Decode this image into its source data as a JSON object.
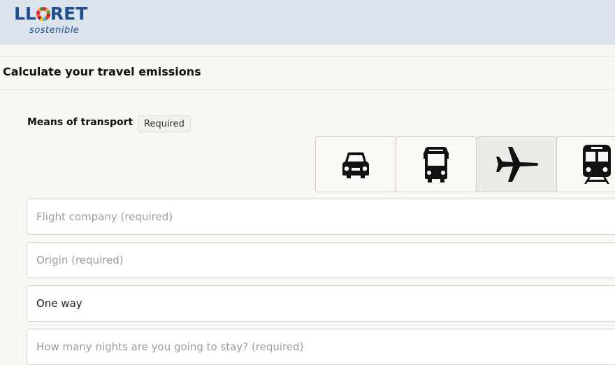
{
  "header": {
    "logo_text_before": "LL",
    "logo_text_after": "RET",
    "logo_subtitle": "sostenible",
    "background": "#dbe3ec",
    "brand_color": "#1f4f8f"
  },
  "page": {
    "title": "Calculate your travel emissions"
  },
  "transport": {
    "label": "Means of transport",
    "required_badge": "Required",
    "options": [
      {
        "name": "car",
        "icon": "car-icon",
        "selected": false
      },
      {
        "name": "bus",
        "icon": "bus-icon",
        "selected": false
      },
      {
        "name": "plane",
        "icon": "airplane-icon",
        "selected": true
      },
      {
        "name": "train",
        "icon": "train-icon",
        "selected": false
      }
    ]
  },
  "form": {
    "flight_company_placeholder": "Flight company (required)",
    "origin_placeholder": "Origin (required)",
    "trip_type_value": "One way",
    "nights_placeholder": "How many nights are you going to stay? (required)"
  }
}
